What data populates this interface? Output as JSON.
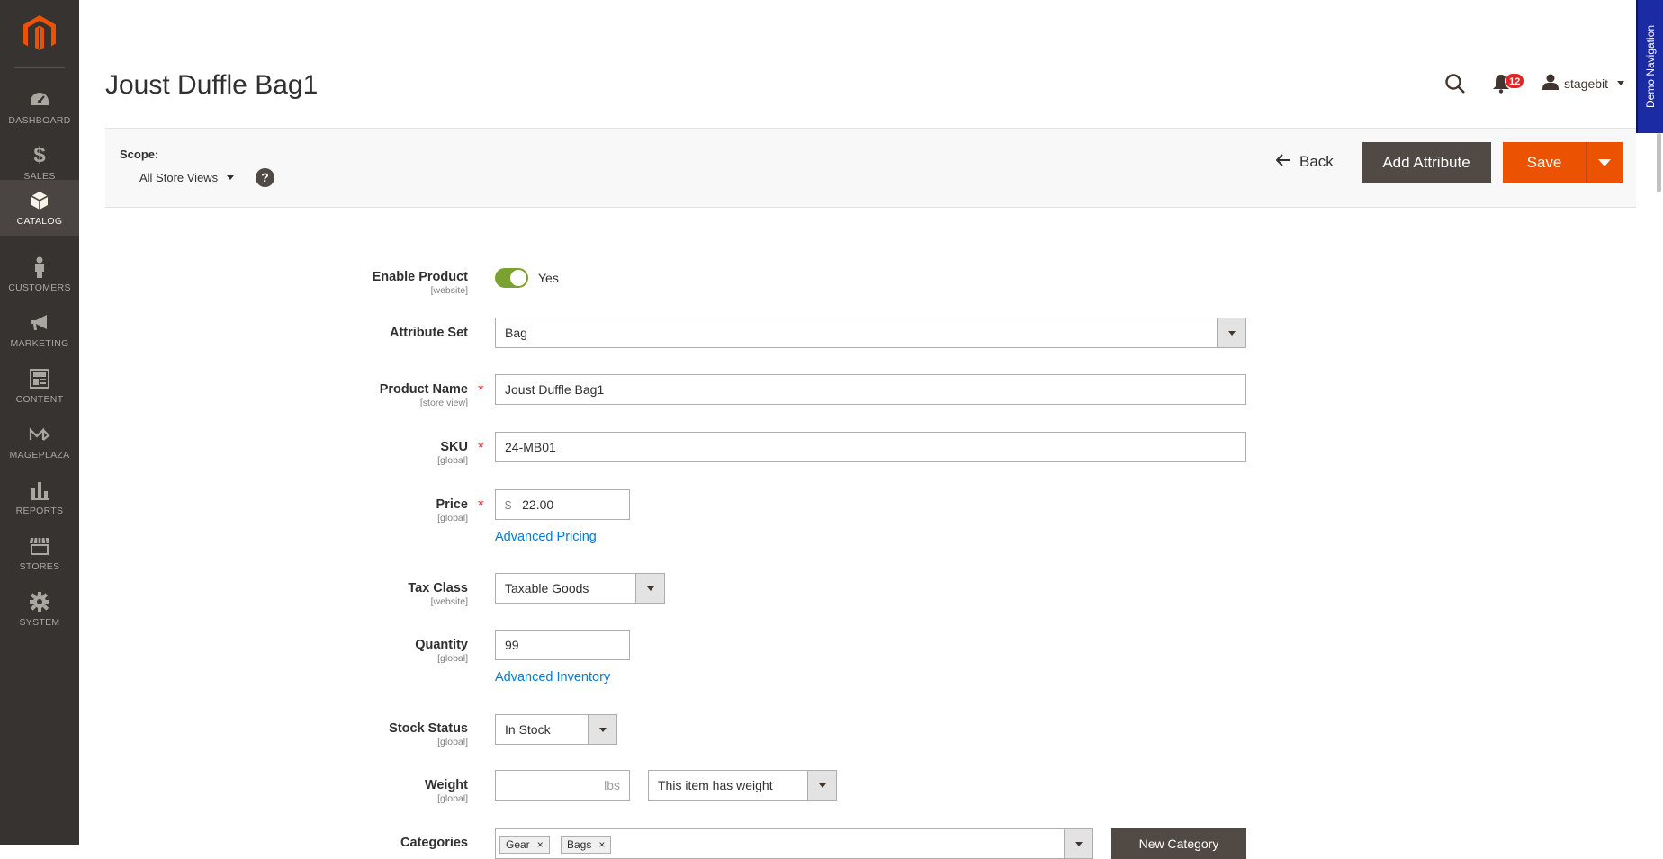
{
  "sidebar": {
    "logo": "magento-logo",
    "items": [
      {
        "label": "DASHBOARD",
        "icon": "dashboard-icon"
      },
      {
        "label": "SALES",
        "icon": "dollar-icon"
      },
      {
        "label": "CATALOG",
        "icon": "box-icon",
        "active": true
      },
      {
        "label": "CUSTOMERS",
        "icon": "person-icon"
      },
      {
        "label": "MARKETING",
        "icon": "megaphone-icon"
      },
      {
        "label": "CONTENT",
        "icon": "content-icon"
      },
      {
        "label": "MAGEPLAZA",
        "icon": "mageplaza-icon"
      },
      {
        "label": "REPORTS",
        "icon": "bar-chart-icon"
      },
      {
        "label": "STORES",
        "icon": "store-icon"
      },
      {
        "label": "SYSTEM",
        "icon": "gear-icon"
      }
    ]
  },
  "header": {
    "title": "Joust Duffle Bag1",
    "notifications_count": "12",
    "username": "stagebit",
    "demo_nav_label": "Demo Navigation"
  },
  "action_bar": {
    "scope_label": "Scope:",
    "scope_value": "All Store Views",
    "help": "?",
    "back_label": "Back",
    "add_attribute_label": "Add Attribute",
    "save_label": "Save"
  },
  "form": {
    "enable_product": {
      "label": "Enable Product",
      "scope": "[website]",
      "value": "Yes",
      "enabled": true
    },
    "attribute_set": {
      "label": "Attribute Set",
      "value": "Bag"
    },
    "product_name": {
      "label": "Product Name",
      "scope": "[store view]",
      "value": "Joust Duffle Bag1",
      "required": "*"
    },
    "sku": {
      "label": "SKU",
      "scope": "[global]",
      "value": "24-MB01",
      "required": "*"
    },
    "price": {
      "label": "Price",
      "scope": "[global]",
      "currency": "$",
      "value": "22.00",
      "required": "*",
      "link": "Advanced Pricing"
    },
    "tax_class": {
      "label": "Tax Class",
      "scope": "[website]",
      "value": "Taxable Goods"
    },
    "quantity": {
      "label": "Quantity",
      "scope": "[global]",
      "value": "99",
      "link": "Advanced Inventory"
    },
    "stock_status": {
      "label": "Stock Status",
      "scope": "[global]",
      "value": "In Stock"
    },
    "weight": {
      "label": "Weight",
      "scope": "[global]",
      "value": "",
      "unit": "lbs",
      "weight_option": "This item has weight"
    },
    "categories": {
      "label": "Categories",
      "tags": [
        "Gear",
        "Bags"
      ],
      "remove": "×",
      "new_category_label": "New Category"
    }
  },
  "colors": {
    "sidebar_bg": "#373330",
    "accent_orange": "#eb5202",
    "dark_button": "#514943",
    "link_blue": "#007bdb",
    "toggle_green": "#79a22e",
    "required_red": "#e22626"
  }
}
